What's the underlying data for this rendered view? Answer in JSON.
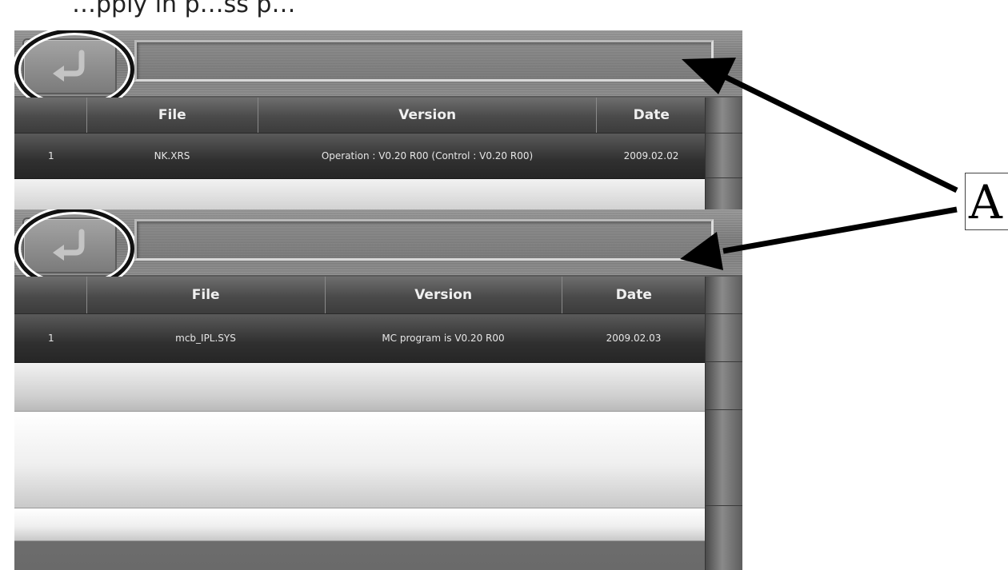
{
  "cropped_caption": "…pply in p…ss p…",
  "annotation": {
    "label": "A"
  },
  "panels": [
    {
      "path_value": "",
      "columns": [
        "",
        "File",
        "Version",
        "Date"
      ],
      "rows": [
        {
          "index": "1",
          "file": "NK.XRS",
          "version": "Operation : V0.20 R00  (Control : V0.20 R00)",
          "date": "2009.02.02"
        }
      ]
    },
    {
      "path_value": "",
      "columns": [
        "",
        "File",
        "Version",
        "Date"
      ],
      "rows": [
        {
          "index": "1",
          "file": "mcb_IPL.SYS",
          "version": "MC program is V0.20 R00",
          "date": "2009.02.03"
        }
      ]
    }
  ],
  "colors": {
    "panel_bg": "#7d7d7d",
    "header_bg": "#4a4a4a",
    "row_bg": "#303030",
    "empty_row_bg": "#d9d9d9",
    "annotation_stroke": "#000000"
  },
  "icons": {
    "back": "return-arrow-icon"
  }
}
